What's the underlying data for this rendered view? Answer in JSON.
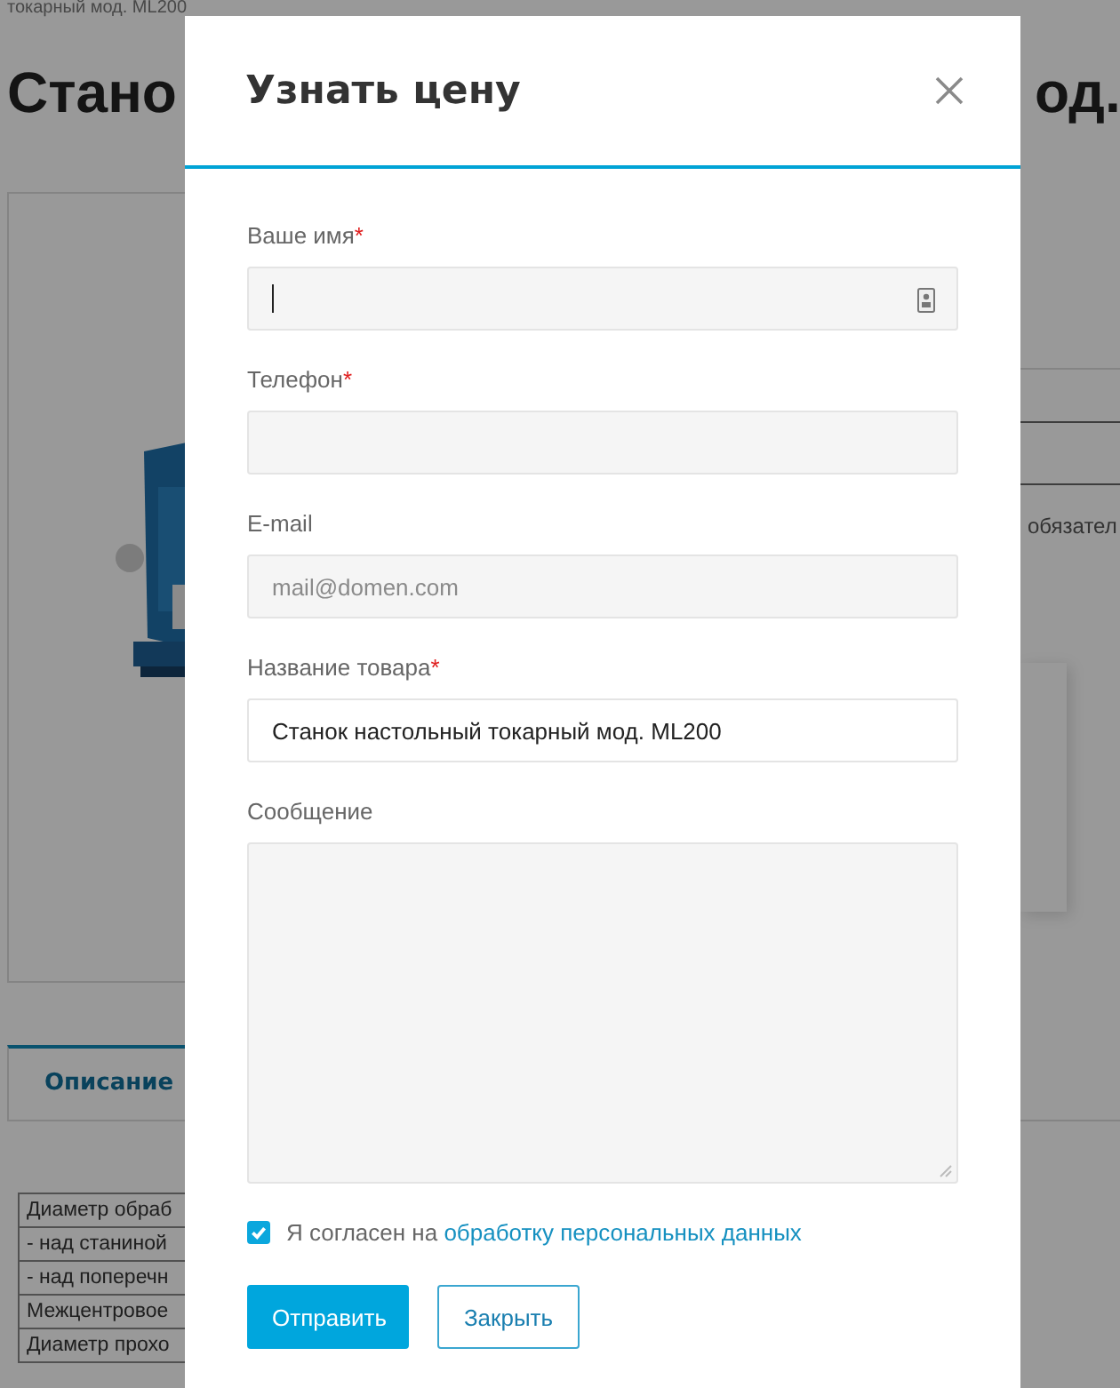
{
  "page": {
    "breadcrumb": "токарный мод. ML200",
    "title_left": "Стано",
    "title_right": "од.",
    "side_note": "обязател",
    "tab": {
      "label": "Описание",
      "selected": true
    },
    "spec_rows": [
      "Диаметр обраб",
      "- над станиной",
      "- над поперечн",
      "Межцентровое",
      "Диаметр прохо"
    ]
  },
  "modal": {
    "title": "Узнать цену",
    "required_mark": "*",
    "fields": [
      {
        "label": "Ваше имя",
        "required": true,
        "kind": "input",
        "focused": true
      },
      {
        "label": "Телефон",
        "required": true,
        "kind": "input",
        "focused": false
      },
      {
        "label": "E-mail",
        "required": false,
        "kind": "input",
        "focused": false,
        "placeholder": "mail@domen.com"
      },
      {
        "label": "Название товара",
        "required": true,
        "kind": "input",
        "focused": false,
        "value": "Станок настольный токарный мод. ML200"
      },
      {
        "label": "Сообщение",
        "required": false,
        "kind": "textarea",
        "focused": false
      }
    ],
    "consent": {
      "checked": true,
      "text": "Я согласен на",
      "link": "обработку персональных данных"
    },
    "buttons": [
      {
        "label": "Отправить",
        "kind": "primary"
      },
      {
        "label": "Закрыть",
        "kind": "secondary"
      }
    ]
  }
}
